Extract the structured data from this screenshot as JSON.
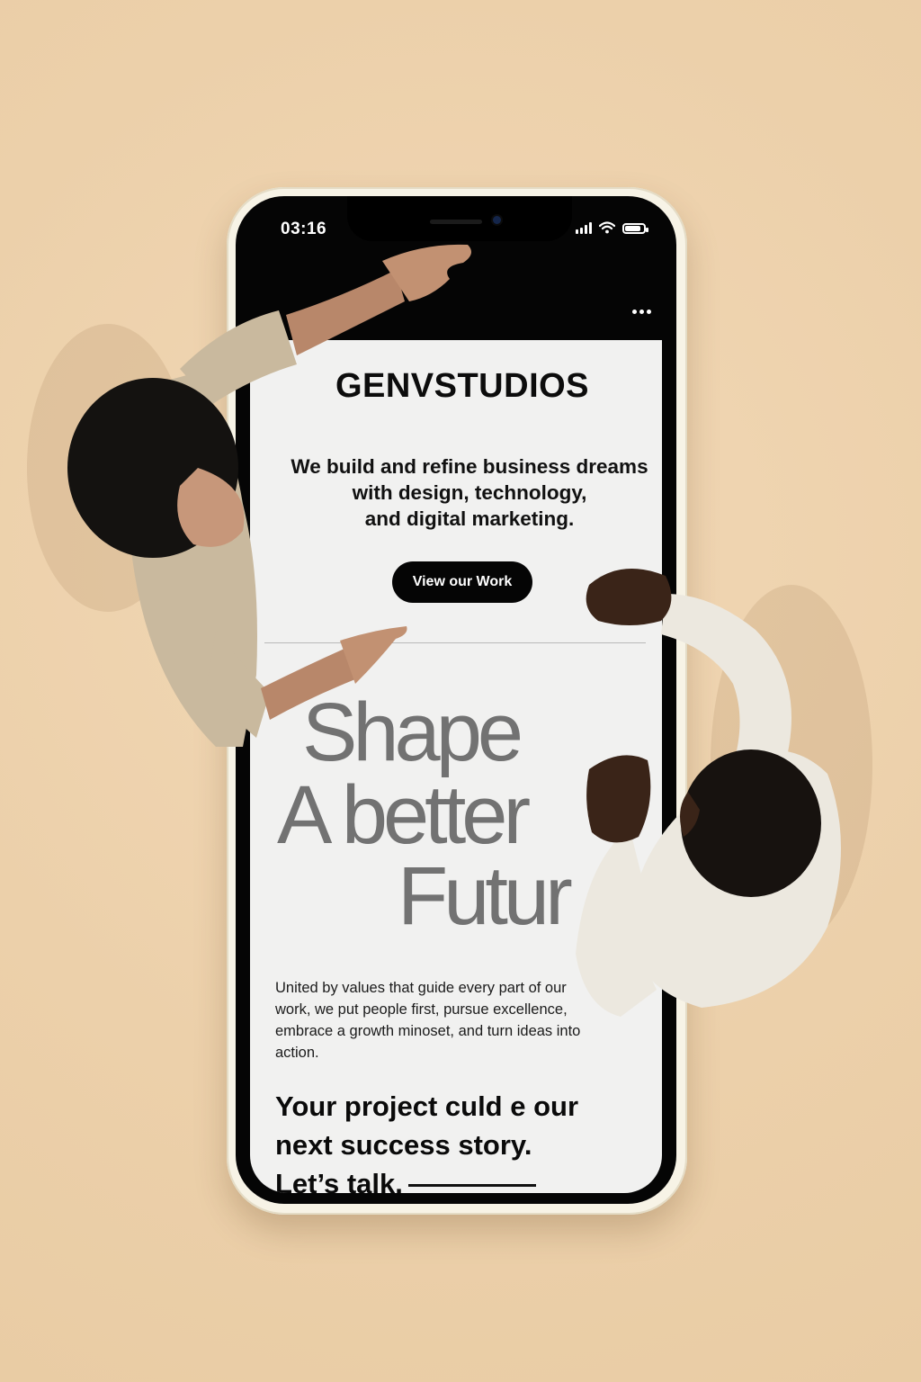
{
  "status": {
    "time": "03:16",
    "battery_level": 0.85
  },
  "site": {
    "brand": "GENVSTUDIOS",
    "tagline_lines": [
      "We build and refine business dreams",
      "with design, technology,",
      "and digital marketing."
    ],
    "cta_button": "View our Work",
    "hero_lines": [
      "Shape",
      "A better",
      "Futur"
    ],
    "values_text": "United by values that guide every part of our work, we put people first, pursue excellence, embrace a growth minoset, and turn ideas into action.",
    "closing_lines": [
      "Your project culd e our",
      "next success story.",
      "Let’s talk."
    ]
  },
  "icons": {
    "signal": "signal-icon",
    "wifi": "wifi-icon",
    "battery": "battery-icon",
    "menu": "more-icon"
  },
  "colors": {
    "background": "#efd3ad",
    "phone_frame": "#f7f3e6",
    "screen": "#f1f1f0",
    "text": "#111111",
    "hero_text": "#727272",
    "button": "#050505"
  }
}
